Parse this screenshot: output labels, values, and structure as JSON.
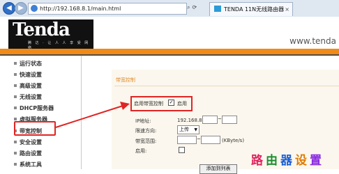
{
  "browser": {
    "url": "http://192.168.8.1/main.html",
    "tab_title": "TENDA 11N无线路由器",
    "tab_close": "×"
  },
  "header": {
    "logo": "Tenda",
    "logo_sub": "腾 达 · 让 人 人 享 受 网 络",
    "website": "www.tenda"
  },
  "sidebar": {
    "items": [
      {
        "label": "运行状态"
      },
      {
        "label": "快速设置"
      },
      {
        "label": "高级设置"
      },
      {
        "label": "无线设置"
      },
      {
        "label": "DHCP服务器"
      },
      {
        "label": "虚拟服务器"
      },
      {
        "label": "带宽控制"
      },
      {
        "label": "安全设置"
      },
      {
        "label": "路由设置"
      },
      {
        "label": "系统工具"
      }
    ],
    "selected": "带宽控制"
  },
  "main": {
    "section_title": "带宽控制",
    "enable_label": "启用带宽控制",
    "enable_checked": true,
    "enable_value": "启用",
    "ip_label": "IP地址:",
    "ip_prefix": "192.168.8.",
    "ip_sep": "~",
    "direction_label": "限速方向:",
    "direction_value": "上传",
    "range_label": "带宽范围:",
    "range_sep": "~",
    "range_unit": "(KByte/s)",
    "enable_row_label": "启用:",
    "add_button": "添加到列表"
  },
  "watermark": {
    "chars": [
      "路",
      "由",
      "器",
      "设",
      "置"
    ],
    "colors": [
      "#e0245e",
      "#1a8f2e",
      "#1c5fd6",
      "#e07b00",
      "#8a2be2"
    ]
  }
}
